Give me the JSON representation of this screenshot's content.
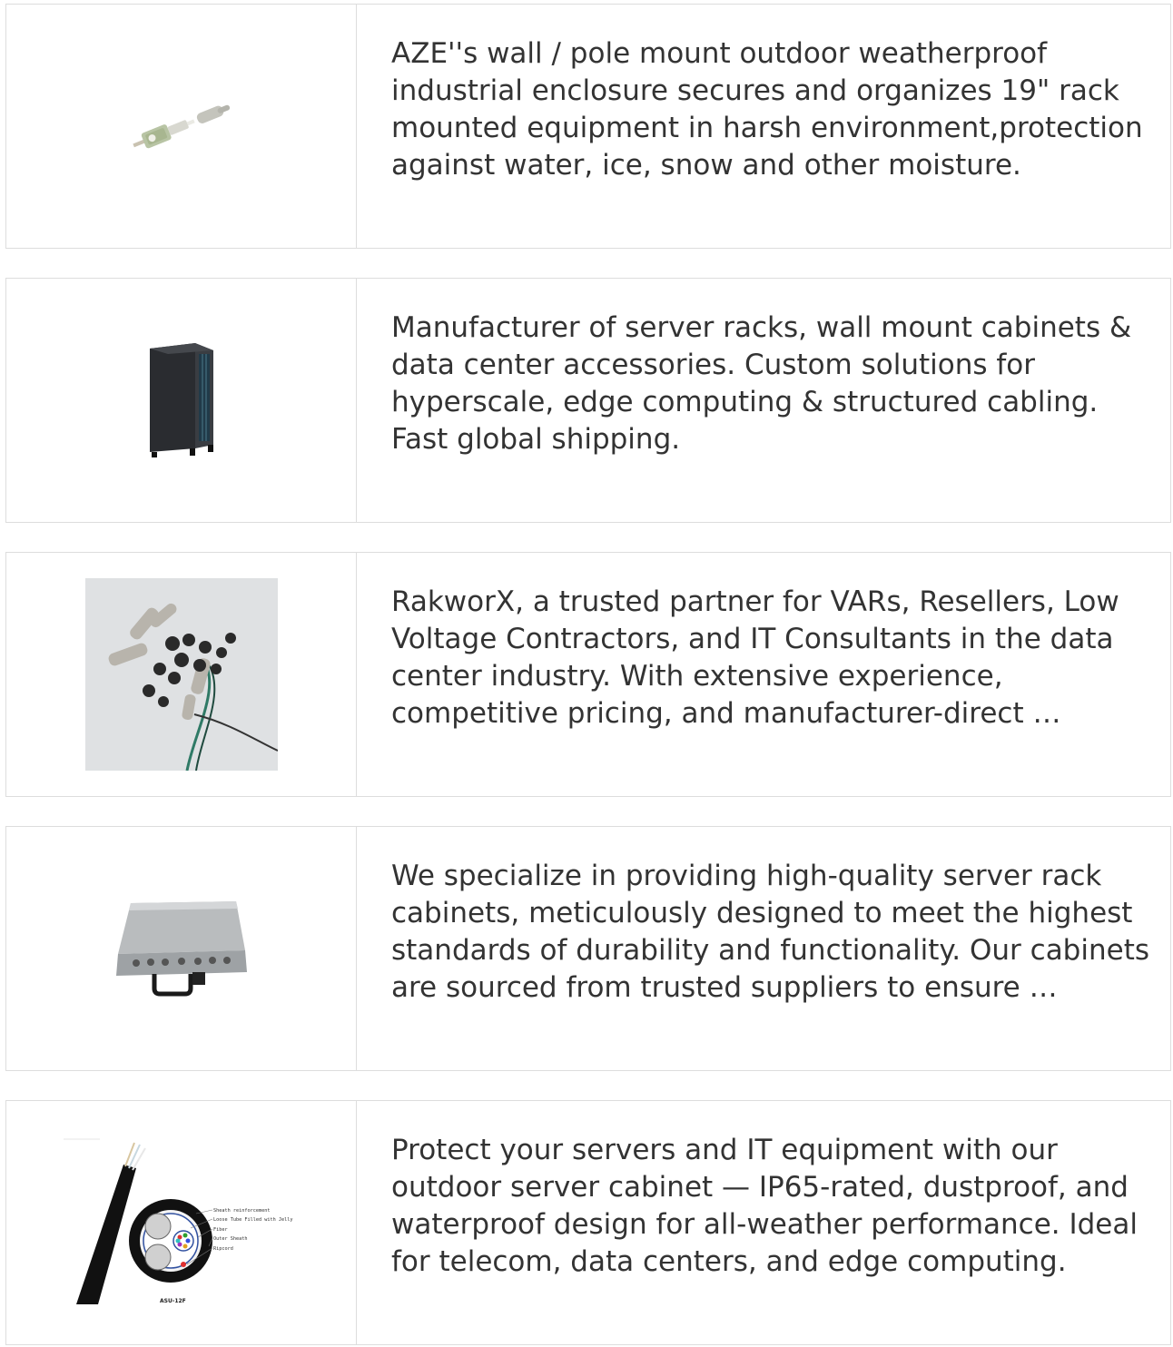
{
  "cards": [
    {
      "image_name": "lc-fiber-connector-image",
      "description": "AZE''s wall / pole mount outdoor weatherproof industrial enclosure secures and organizes 19\" rack mounted equipment in harsh environment,protection against water, ice, snow and other moisture."
    },
    {
      "image_name": "server-rack-cabinet-image",
      "description": "Manufacturer of server racks, wall mount cabinets & data center accessories. Custom solutions for hyperscale, edge computing & structured cabling. Fast global shipping."
    },
    {
      "image_name": "cable-connector-kit-image",
      "description": "RakworX, a trusted partner for VARs, Resellers, Low Voltage Contractors, and IT Consultants in the data center industry. With extensive experience, competitive pricing, and manufacturer-direct …"
    },
    {
      "image_name": "rack-mount-chassis-image",
      "description": "We specialize in providing high-quality server rack cabinets, meticulously designed to meet the highest standards of durability and functionality. Our cabinets are sourced from trusted suppliers to ensure …"
    },
    {
      "image_name": "fiber-cable-diagram-image",
      "description": "Protect your servers and IT equipment with our outdoor server cabinet — IP65-rated, dustproof, and waterproof design for all-weather performance. Ideal for telecom, data centers, and edge computing.",
      "diagram_labels": [
        "Sheath reinforcement",
        "Loose Tube Filled with Jelly",
        "Fiber",
        "Outer Sheath",
        "Ripcord"
      ],
      "diagram_caption": "ASU-12F"
    }
  ]
}
